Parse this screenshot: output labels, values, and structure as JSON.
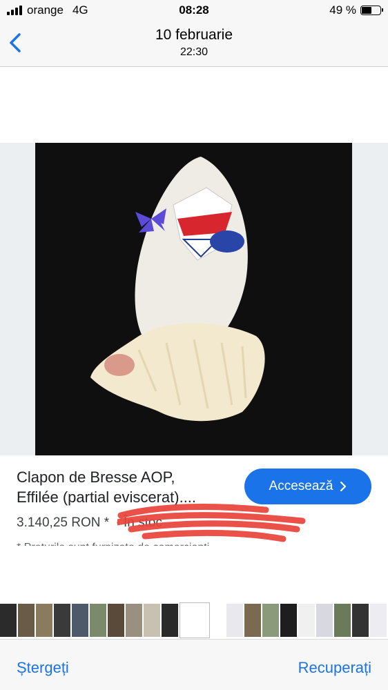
{
  "status_bar": {
    "carrier": "orange",
    "network": "4G",
    "time": "08:28",
    "battery_text": "49 %",
    "battery_level": 0.49
  },
  "nav": {
    "title": "10 februarie",
    "subtitle": "22:30",
    "back_icon": "chevron-left-icon"
  },
  "product": {
    "title_line1": "Clapon de Bresse AOP,",
    "title_line2": "Effilée (partial eviscerat)....",
    "price": "3.140,25 RON *",
    "stock_prefix": "· În stoc",
    "button_label": "Accesează",
    "button_icon": "chevron-right-icon",
    "footnote": "* Prețurile sunt furnizate de comercianți"
  },
  "bottom_toolbar": {
    "delete_label": "Ștergeți",
    "recover_label": "Recuperați"
  },
  "colors": {
    "accent": "#1a73e8",
    "photo_background": "#0f0f10",
    "redaction": "#e8433a"
  }
}
